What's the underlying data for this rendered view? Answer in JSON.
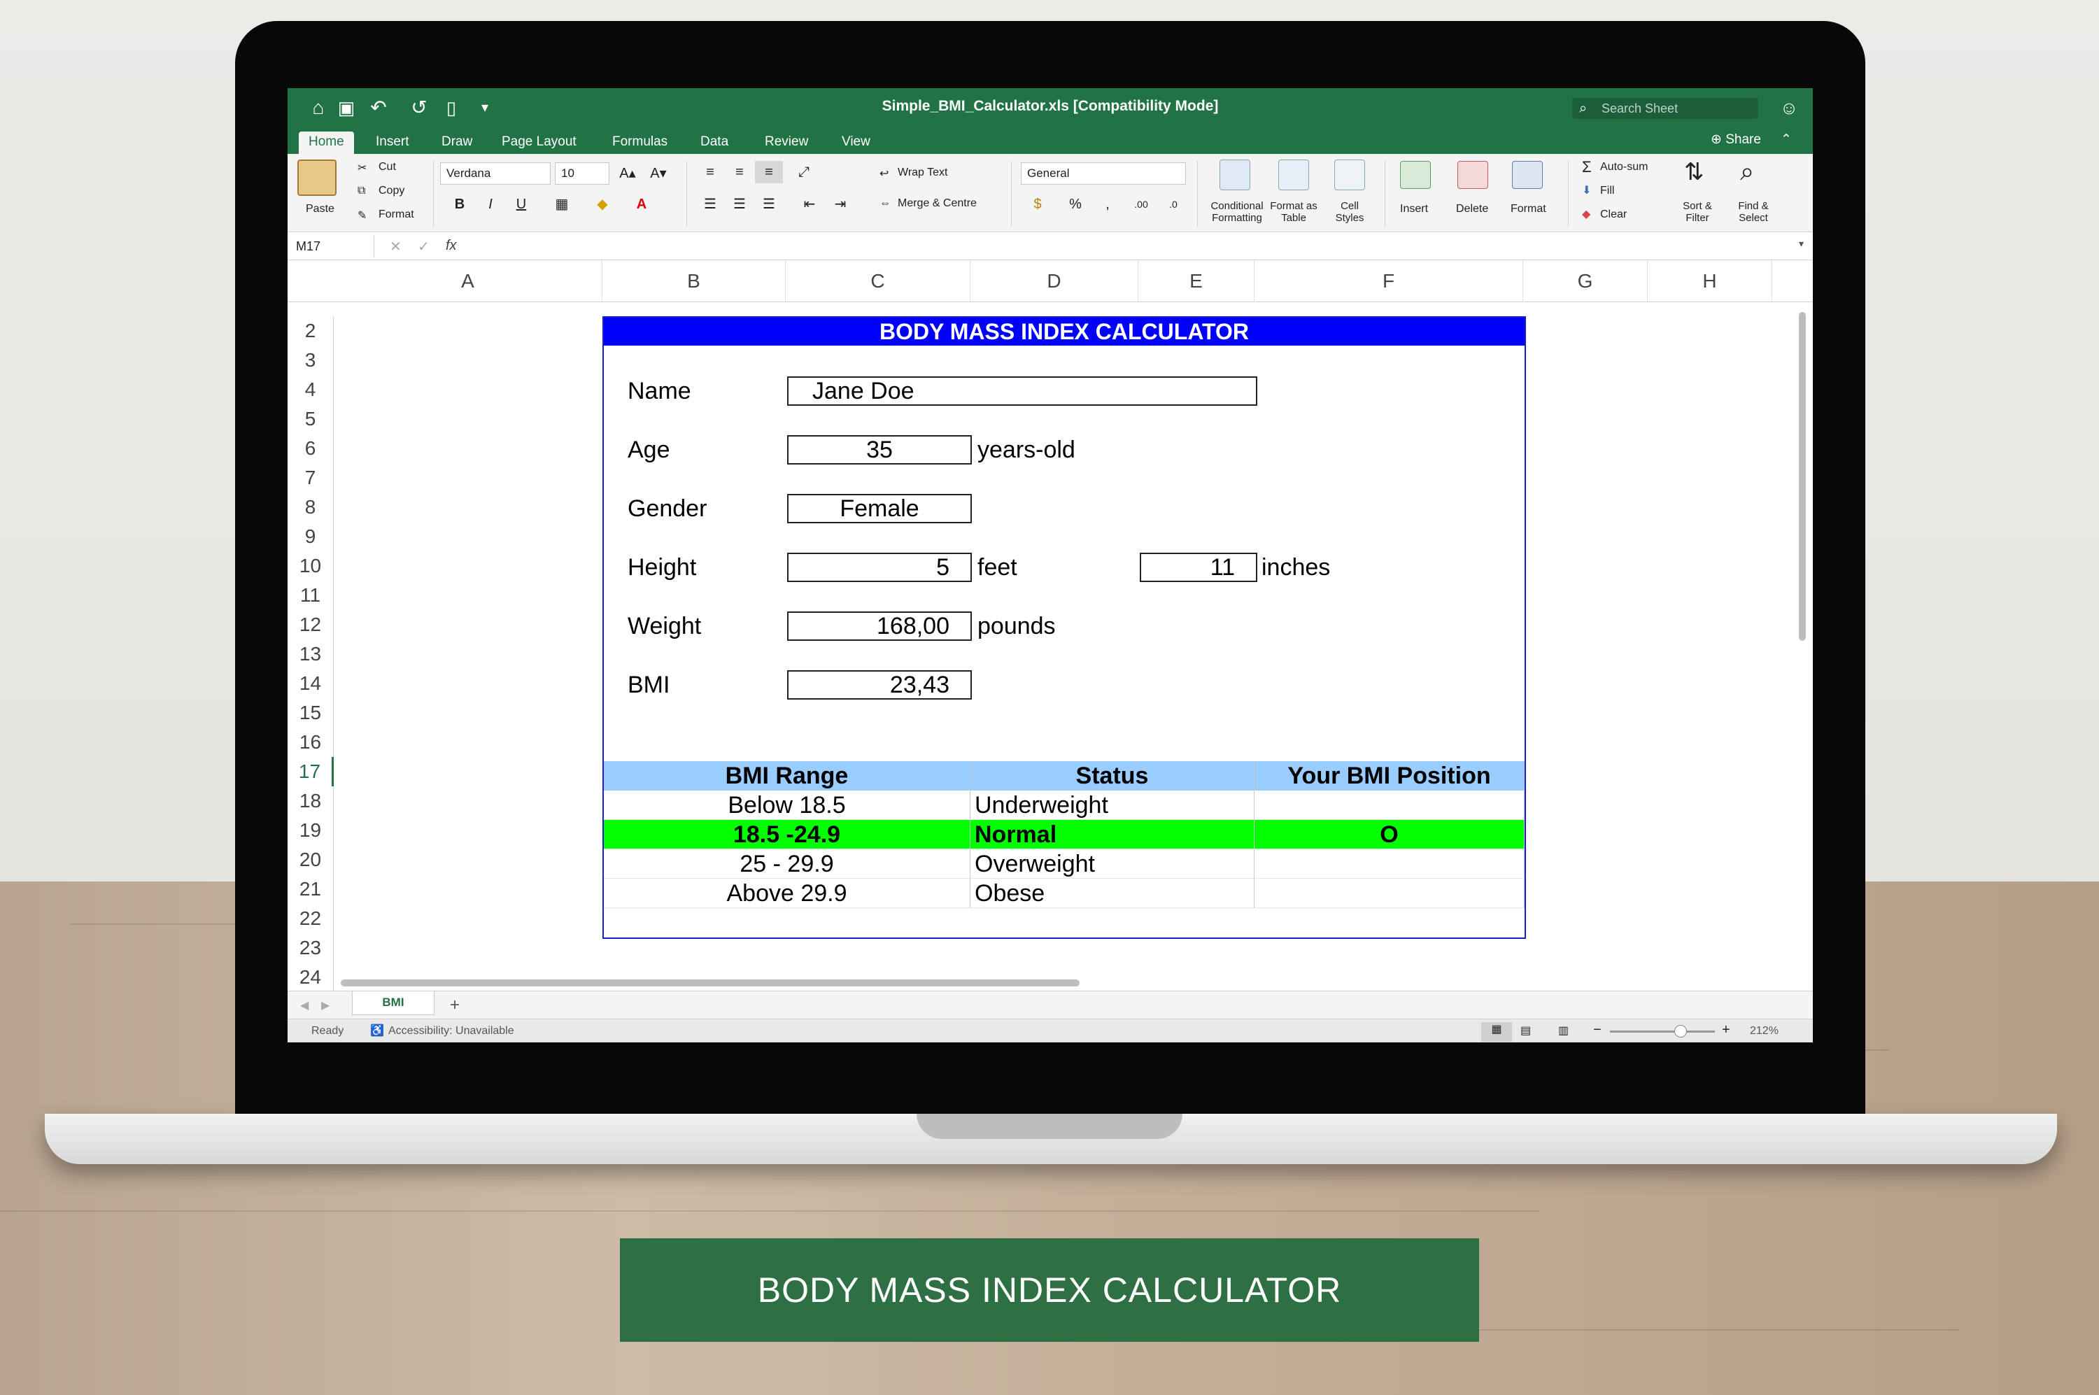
{
  "window": {
    "title": "Simple_BMI_Calculator.xls  [Compatibility Mode]",
    "search_placeholder": "Search Sheet",
    "share_label": "Share"
  },
  "ribbon_tabs": [
    "Home",
    "Insert",
    "Draw",
    "Page Layout",
    "Formulas",
    "Data",
    "Review",
    "View"
  ],
  "ribbon": {
    "paste": "Paste",
    "cut": "Cut",
    "copy": "Copy",
    "format_painter": "Format",
    "font_name": "Verdana",
    "font_size": "10",
    "bold": "B",
    "italic": "I",
    "underline": "U",
    "wrap_text": "Wrap Text",
    "merge_centre": "Merge & Centre",
    "number_format": "General",
    "percent": "%",
    "conditional_formatting": "Conditional Formatting",
    "format_as_table": "Format as Table",
    "cell_styles": "Cell Styles",
    "insert": "Insert",
    "delete": "Delete",
    "format": "Format",
    "autosum": "Auto-sum",
    "fill": "Fill",
    "clear": "Clear",
    "sort_filter": "Sort & Filter",
    "find_select": "Find & Select"
  },
  "formula_bar": {
    "name_box": "M17",
    "fx": "fx",
    "content": ""
  },
  "columns": [
    "A",
    "B",
    "C",
    "D",
    "E",
    "F",
    "G",
    "H"
  ],
  "rows": [
    "2",
    "3",
    "4",
    "5",
    "6",
    "7",
    "8",
    "9",
    "10",
    "11",
    "12",
    "13",
    "14",
    "15",
    "16",
    "17",
    "18",
    "19",
    "20",
    "21",
    "22",
    "23",
    "24"
  ],
  "selected_row": "17",
  "calculator": {
    "title": "BODY MASS INDEX CALCULATOR",
    "name_label": "Name",
    "name_value": "Jane Doe",
    "age_label": "Age",
    "age_value": "35",
    "age_unit": "years-old",
    "gender_label": "Gender",
    "gender_value": "Female",
    "height_label": "Height",
    "height_feet": "5",
    "feet_unit": "feet",
    "height_inches": "11",
    "inches_unit": "inches",
    "weight_label": "Weight",
    "weight_value": "168,00",
    "weight_unit": "pounds",
    "bmi_label": "BMI",
    "bmi_value": "23,43"
  },
  "bmi_table": {
    "headers": [
      "BMI Range",
      "Status",
      "Your BMI Position"
    ],
    "rows": [
      {
        "range": "Below 18.5",
        "status": "Underweight",
        "position": ""
      },
      {
        "range": "18.5 -24.9",
        "status": "Normal",
        "position": "O"
      },
      {
        "range": "25 - 29.9",
        "status": "Overweight",
        "position": ""
      },
      {
        "range": "Above 29.9",
        "status": "Obese",
        "position": ""
      }
    ]
  },
  "sheet_tab": "BMI",
  "status": {
    "ready": "Ready",
    "accessibility": "Accessibility: Unavailable",
    "zoom": "212%"
  },
  "banner": "BODY MASS INDEX CALCULATOR",
  "colors": {
    "excel_green": "#217346",
    "title_blue": "#0000ff",
    "header_blue": "#99ccff",
    "highlight_green": "#00ff00"
  }
}
